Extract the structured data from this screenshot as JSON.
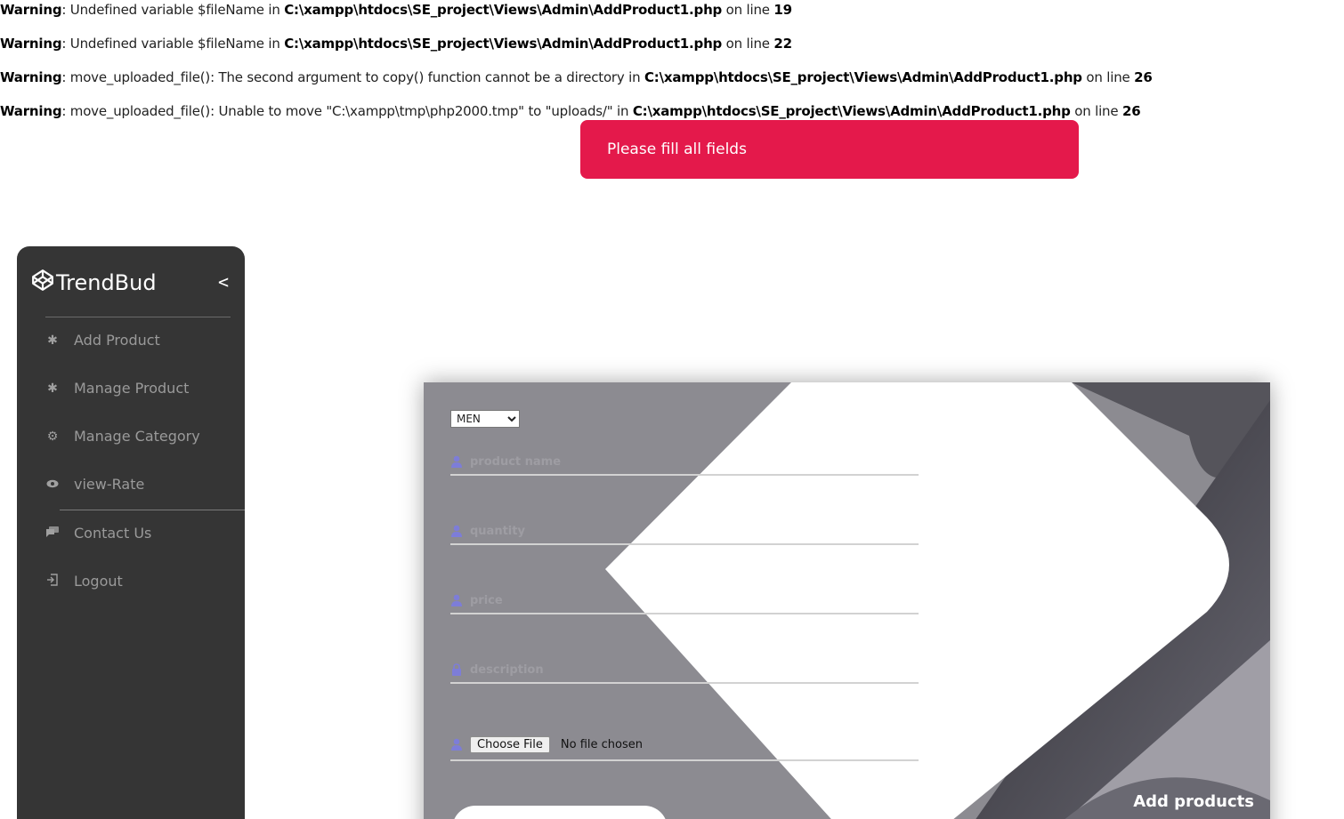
{
  "warnings": [
    {
      "label": "Warning",
      "message": ": Undefined variable $fileName in ",
      "file": "C:\\xampp\\htdocs\\SE_project\\Views\\Admin\\AddProduct1.php",
      "on_line": " on line ",
      "line": "19"
    },
    {
      "label": "Warning",
      "message": ": Undefined variable $fileName in ",
      "file": "C:\\xampp\\htdocs\\SE_project\\Views\\Admin\\AddProduct1.php",
      "on_line": " on line ",
      "line": "22"
    },
    {
      "label": "Warning",
      "message": ": move_uploaded_file(): The second argument to copy() function cannot be a directory in ",
      "file": "C:\\xampp\\htdocs\\SE_project\\Views\\Admin\\AddProduct1.php",
      "on_line": " on line ",
      "line": "26"
    },
    {
      "label": "Warning",
      "message": ": move_uploaded_file(): Unable to move \"C:\\xampp\\tmp\\php2000.tmp\" to \"uploads/\" in ",
      "file": "C:\\xampp\\htdocs\\SE_project\\Views\\Admin\\AddProduct1.php",
      "on_line": " on line ",
      "line": "26"
    }
  ],
  "alert": {
    "text": "Please fill all fields",
    "color": "#e4194b"
  },
  "sidebar": {
    "brand": "TrendBud",
    "collapse": "<",
    "items": [
      {
        "label": "Add Product",
        "icon": "asterisk-icon"
      },
      {
        "label": "Manage Product",
        "icon": "asterisk-icon"
      },
      {
        "label": "Manage Category",
        "icon": "gear-icon"
      },
      {
        "label": "view-Rate",
        "icon": "eye-icon"
      },
      {
        "label": "Contact Us",
        "icon": "chat-icon"
      },
      {
        "label": "Logout",
        "icon": "logout-icon"
      }
    ]
  },
  "form": {
    "category": {
      "selected": "MEN",
      "options": [
        "MEN"
      ]
    },
    "fields": {
      "name_placeholder": "product name",
      "quantity_placeholder": "quantity",
      "price_placeholder": "price",
      "description_placeholder": "description"
    },
    "file": {
      "button": "Choose File",
      "status": "No file chosen"
    },
    "title": "Add products"
  }
}
